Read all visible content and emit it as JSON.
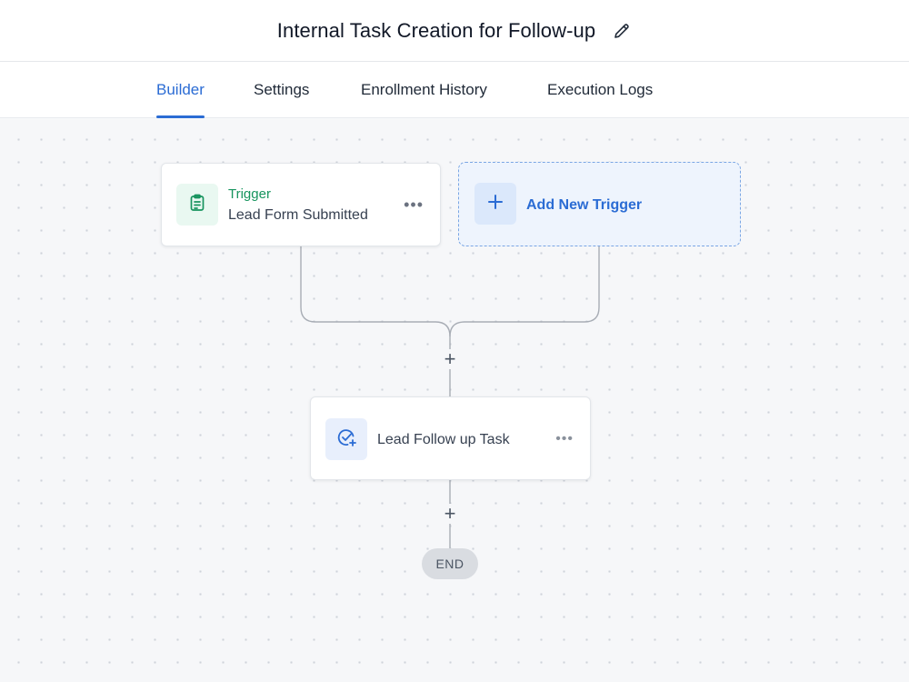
{
  "header": {
    "title": "Internal Task Creation for Follow-up",
    "edit_icon": "pencil-icon"
  },
  "tabs": [
    {
      "label": "Builder",
      "active": true
    },
    {
      "label": "Settings",
      "active": false
    },
    {
      "label": "Enrollment History",
      "active": false
    },
    {
      "label": "Execution Logs",
      "active": false
    }
  ],
  "workflow": {
    "trigger": {
      "label": "Trigger",
      "event": "Lead Form Submitted",
      "icon": "clipboard-icon",
      "menu_glyph": "•••"
    },
    "add_trigger": {
      "label": "Add New Trigger",
      "icon": "plus-icon"
    },
    "action": {
      "label": "Lead Follow up Task",
      "icon": "task-check-icon",
      "menu_glyph": "•••"
    },
    "add_step_glyph": "+",
    "end_label": "END"
  },
  "colors": {
    "accent": "#2b6cd4",
    "trigger_green": "#17945e",
    "canvas_bg": "#f6f7f9"
  }
}
